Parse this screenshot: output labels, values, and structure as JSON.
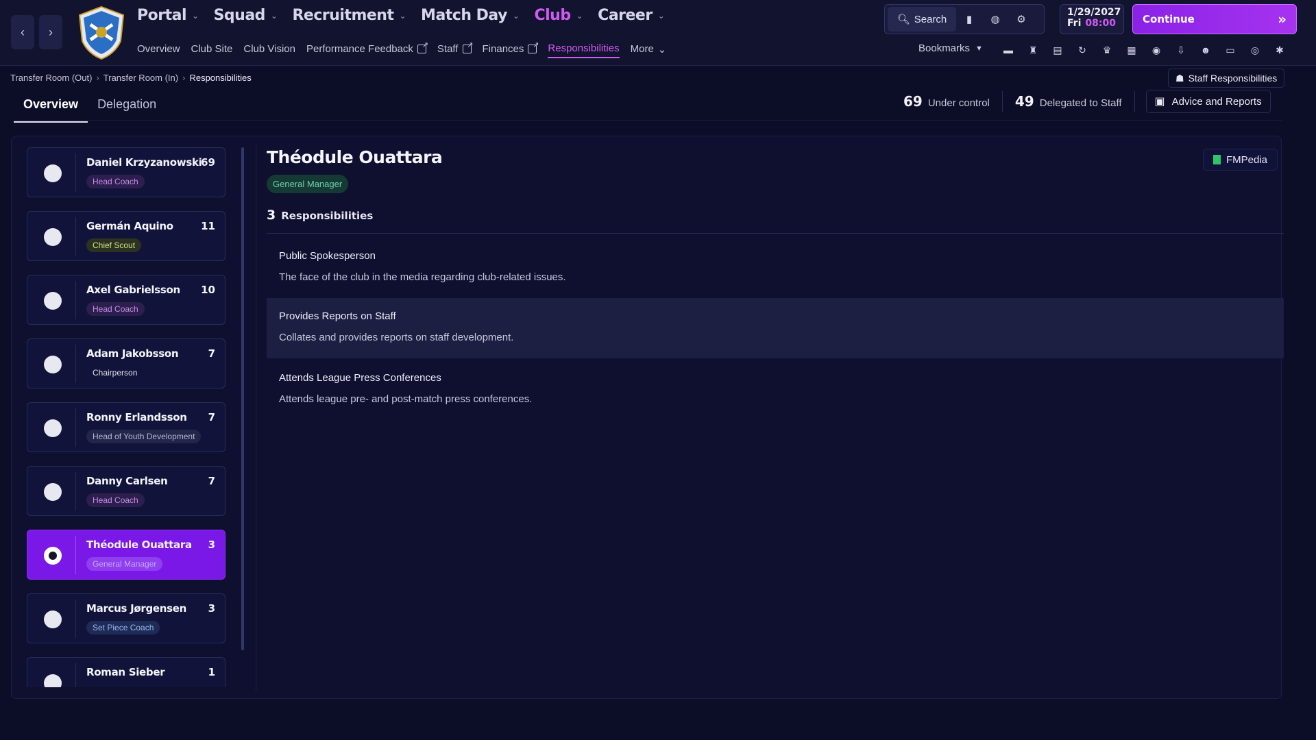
{
  "header": {
    "main_nav": [
      {
        "label": "Portal",
        "active": false
      },
      {
        "label": "Squad",
        "active": false
      },
      {
        "label": "Recruitment",
        "active": false
      },
      {
        "label": "Match Day",
        "active": false
      },
      {
        "label": "Club",
        "active": true
      },
      {
        "label": "Career",
        "active": false
      }
    ],
    "sub_nav": [
      {
        "label": "Overview",
        "external": false,
        "active": false
      },
      {
        "label": "Club Site",
        "external": false,
        "active": false
      },
      {
        "label": "Club Vision",
        "external": false,
        "active": false
      },
      {
        "label": "Performance Feedback",
        "external": true,
        "active": false
      },
      {
        "label": "Staff",
        "external": true,
        "active": false
      },
      {
        "label": "Finances",
        "external": true,
        "active": false
      },
      {
        "label": "Responsibilities",
        "external": false,
        "active": true
      },
      {
        "label": "More",
        "external": false,
        "active": false
      }
    ],
    "search_label": "Search",
    "date_line1": "1/29/2027",
    "date_day": "Fri",
    "date_time": "08:00",
    "continue_label": "Continue",
    "bookmarks_label": "Bookmarks",
    "accent_color": "#cf5cf2"
  },
  "breadcrumb": [
    "Transfer Room (Out)",
    "Transfer Room (In)",
    "Responsibilities"
  ],
  "staff_responsibilities_label": "Staff Responsibilities",
  "tabs": [
    {
      "label": "Overview",
      "active": true
    },
    {
      "label": "Delegation",
      "active": false
    }
  ],
  "stats": {
    "under_control_value": "69",
    "under_control_label": "Under control",
    "delegated_value": "49",
    "delegated_label": "Delegated to Staff",
    "advice_label": "Advice and Reports"
  },
  "staff": [
    {
      "name": "Daniel Krzyzanowski",
      "count": "69",
      "role": "Head Coach",
      "role_style": "role-head",
      "selected": false
    },
    {
      "name": "Germán Aquino",
      "count": "11",
      "role": "Chief Scout",
      "role_style": "role-scout",
      "selected": false
    },
    {
      "name": "Axel Gabrielsson",
      "count": "10",
      "role": "Head Coach",
      "role_style": "role-head",
      "selected": false
    },
    {
      "name": "Adam Jakobsson",
      "count": "7",
      "role": "Chairperson",
      "role_style": "role-plain",
      "selected": false
    },
    {
      "name": "Ronny Erlandsson",
      "count": "7",
      "role": "Head of Youth Development",
      "role_style": "role-youth",
      "selected": false
    },
    {
      "name": "Danny Carlsen",
      "count": "7",
      "role": "Head Coach",
      "role_style": "role-head",
      "selected": false
    },
    {
      "name": "Théodule Ouattara",
      "count": "3",
      "role": "General Manager",
      "role_style": "role-gm",
      "selected": true
    },
    {
      "name": "Marcus Jørgensen",
      "count": "3",
      "role": "Set Piece Coach",
      "role_style": "role-setpiece",
      "selected": false
    },
    {
      "name": "Roman Sieber",
      "count": "1",
      "role": "",
      "role_style": "role-plain",
      "selected": false
    }
  ],
  "detail": {
    "name": "Théodule Ouattara",
    "role": "General Manager",
    "fmpedia_label": "FMPedia",
    "count": "3",
    "count_label": "Responsibilities",
    "responsibilities": [
      {
        "title": "Public Spokesperson",
        "description": "The face of the club in the media regarding club-related issues."
      },
      {
        "title": "Provides Reports on Staff",
        "description": "Collates and provides reports on staff development."
      },
      {
        "title": "Attends League Press Conferences",
        "description": "Attends league pre- and post-match press conferences."
      }
    ]
  }
}
